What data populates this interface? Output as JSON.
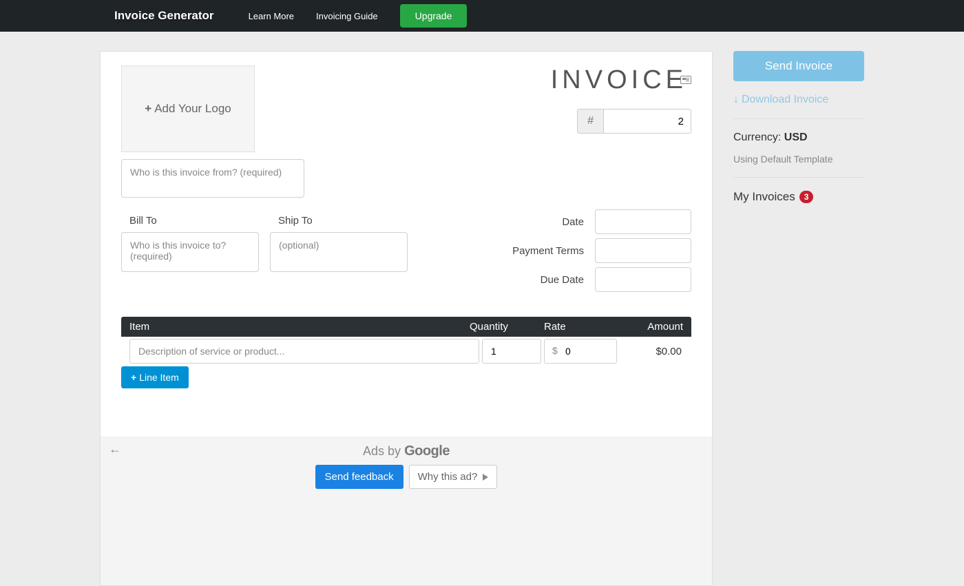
{
  "nav": {
    "brand": "Invoice Generator",
    "learn_more": "Learn More",
    "invoicing_guide": "Invoicing Guide",
    "upgrade": "Upgrade"
  },
  "invoice": {
    "add_logo": "Add Your Logo",
    "title": "INVOICE",
    "number_prefix": "#",
    "number_value": "2",
    "from_placeholder": "Who is this invoice from? (required)",
    "bill_to_label": "Bill To",
    "bill_to_placeholder": "Who is this invoice to? (required)",
    "ship_to_label": "Ship To",
    "ship_to_placeholder": "(optional)",
    "date_label": "Date",
    "payment_terms_label": "Payment Terms",
    "due_date_label": "Due Date",
    "date_value": "",
    "payment_terms_value": "",
    "due_date_value": ""
  },
  "table": {
    "h_item": "Item",
    "h_quantity": "Quantity",
    "h_rate": "Rate",
    "h_amount": "Amount",
    "row": {
      "desc_placeholder": "Description of service or product...",
      "quantity": "1",
      "rate_currency": "$",
      "rate_value": "0",
      "amount": "$0.00"
    },
    "add_line": "Line Item"
  },
  "ads": {
    "label_prefix": "Ads by ",
    "label_brand": "Google",
    "send_feedback": "Send feedback",
    "why_this_ad": "Why this ad?"
  },
  "sidebar": {
    "send": "Send Invoice",
    "download": "Download Invoice",
    "currency_label": "Currency: ",
    "currency_value": "USD",
    "template": "Using Default Template",
    "my_invoices": "My Invoices",
    "badge": "3"
  }
}
